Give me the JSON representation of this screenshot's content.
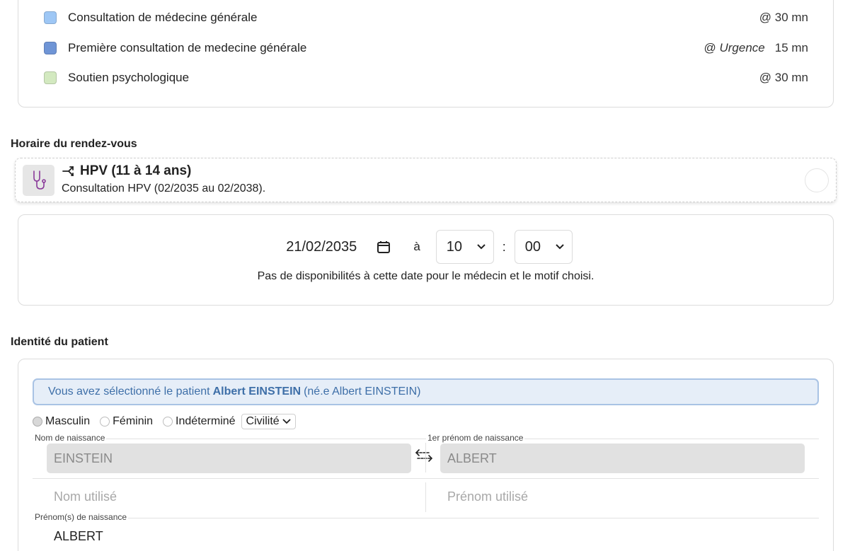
{
  "motifs": [
    {
      "label": "Consultation de médecine générale",
      "color": "#9ec7f5",
      "tag": "",
      "duration": "@ 30 mn"
    },
    {
      "label": "Première consultation de medecine générale",
      "color": "#6f95d6",
      "tag": "Urgence",
      "duration": "15 mn",
      "prefix": "@"
    },
    {
      "label": "Soutien psychologique",
      "color": "#d3e9c0",
      "tag": "",
      "duration": "@ 30 mn"
    }
  ],
  "horaire": {
    "section_title": "Horaire du rendez-vous",
    "vaccine_title": "HPV (11 à 14 ans)",
    "vaccine_sub": "Consultation HPV (02/2035 au 02/2038).",
    "date": "21/02/2035",
    "a_label": "à",
    "hour": "10",
    "colon": ":",
    "minute": "00",
    "no_dispo": "Pas de disponibilités à cette date pour le médecin et le motif choisi."
  },
  "identity": {
    "section_title": "Identité du patient",
    "banner_pre": "Vous avez sélectionné le patient",
    "banner_name": "Albert EINSTEIN",
    "banner_post": "(né.e Albert EINSTEIN)",
    "gender_options": [
      "Masculin",
      "Féminin",
      "Indéterminé"
    ],
    "civilite": "Civilité",
    "nom_naissance_label": "Nom de naissance",
    "nom_naissance": "EINSTEIN",
    "prenom_naissance_label": "1er prénom de naissance",
    "prenom_naissance": "ALBERT",
    "nom_utilise_ph": "Nom utilisé",
    "prenom_utilise_ph": "Prénom utilisé",
    "prenoms_naissance_label": "Prénom(s) de naissance",
    "prenoms_naissance": "ALBERT"
  }
}
